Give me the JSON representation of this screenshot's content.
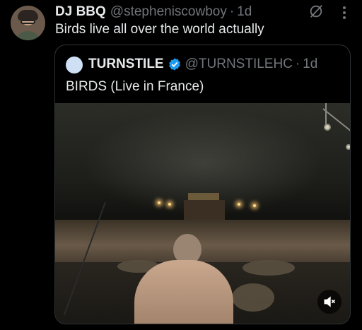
{
  "post": {
    "author_name": "DJ BBQ",
    "handle": "@stepheniscowboy",
    "separator": "·",
    "time": "1d",
    "text": "Birds live all over the world actually"
  },
  "quoted_post": {
    "author_name": "TURNSTILE",
    "verified": true,
    "handle": "@TURNSTILEHC",
    "separator": "·",
    "time": "1d",
    "text": "BIRDS (Live in France)",
    "media": {
      "type": "video",
      "muted": true
    }
  },
  "icons": {
    "grok": "grok-icon",
    "more": "more-vertical-icon",
    "verified": "verified-badge-icon",
    "mute": "volume-muted-icon"
  },
  "colors": {
    "background": "#000000",
    "primary_text": "#e7e9ea",
    "secondary_text": "#71767b",
    "border": "#2f3336",
    "verified_blue": "#1d9bf0"
  }
}
